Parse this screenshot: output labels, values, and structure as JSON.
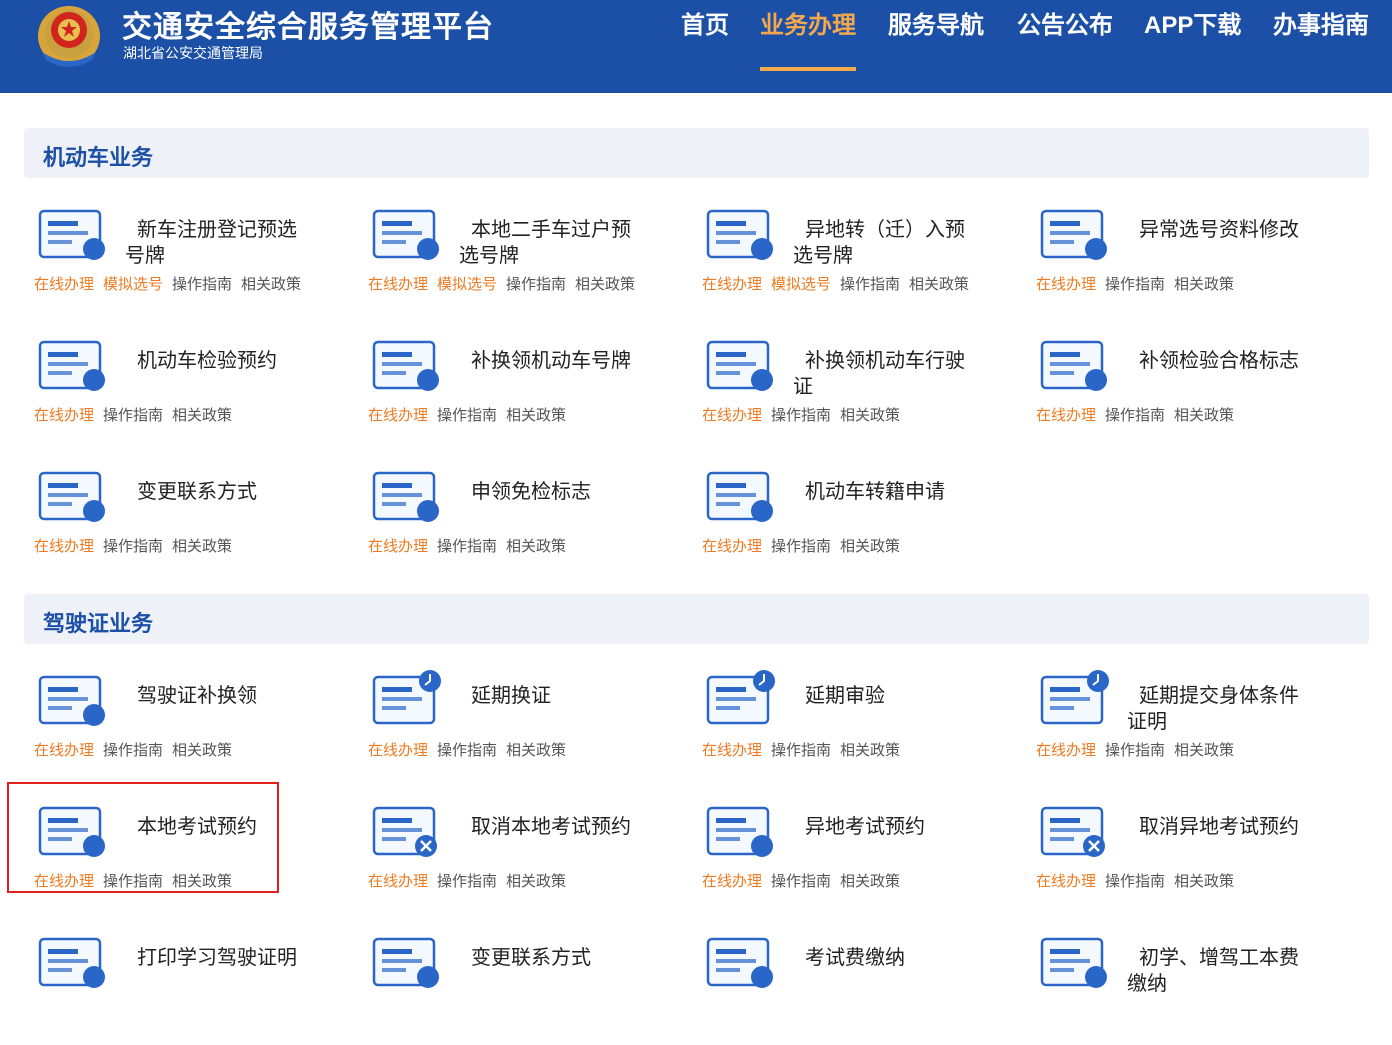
{
  "header": {
    "title": "交通安全综合服务管理平台",
    "subtitle": "湖北省公安交通管理局",
    "nav": [
      {
        "label": "首页",
        "active": false
      },
      {
        "label": "业务办理",
        "active": true
      },
      {
        "label": "服务导航",
        "active": false
      },
      {
        "label": "公告公布",
        "active": false
      },
      {
        "label": "APP下载",
        "active": false
      },
      {
        "label": "办事指南",
        "active": false
      }
    ]
  },
  "sections": [
    {
      "title": "机动车业务",
      "cards": [
        {
          "title": "新车注册登记预选号牌",
          "icon": "plate-registration-icon",
          "links": [
            "在线办理",
            "模拟选号",
            "操作指南",
            "相关政策"
          ]
        },
        {
          "title": "本地二手车过户预选号牌",
          "icon": "car-transfer-icon",
          "links": [
            "在线办理",
            "模拟选号",
            "操作指南",
            "相关政策"
          ]
        },
        {
          "title": "异地转（迁）入预选号牌",
          "icon": "car-relocate-icon",
          "links": [
            "在线办理",
            "模拟选号",
            "操作指南",
            "相关政策"
          ]
        },
        {
          "title": "异常选号资料修改",
          "icon": "number-edit-icon",
          "links": [
            "在线办理",
            "操作指南",
            "相关政策"
          ]
        },
        {
          "title": "机动车检验预约",
          "icon": "inspection-booking-icon",
          "links": [
            "在线办理",
            "操作指南",
            "相关政策"
          ]
        },
        {
          "title": "补换领机动车号牌",
          "icon": "plate-replace-icon",
          "links": [
            "在线办理",
            "操作指南",
            "相关政策"
          ]
        },
        {
          "title": "补换领机动车行驶证",
          "icon": "license-replace-icon",
          "links": [
            "在线办理",
            "操作指南",
            "相关政策"
          ]
        },
        {
          "title": "补领检验合格标志",
          "icon": "inspection-mark-icon",
          "links": [
            "在线办理",
            "操作指南",
            "相关政策"
          ]
        },
        {
          "title": "变更联系方式",
          "icon": "contact-change-icon",
          "links": [
            "在线办理",
            "操作指南",
            "相关政策"
          ]
        },
        {
          "title": "申领免检标志",
          "icon": "exempt-mark-icon",
          "links": [
            "在线办理",
            "操作指南",
            "相关政策"
          ]
        },
        {
          "title": "机动车转籍申请",
          "icon": "transfer-registry-icon",
          "links": [
            "在线办理",
            "操作指南",
            "相关政策"
          ]
        }
      ]
    },
    {
      "title": "驾驶证业务",
      "cards": [
        {
          "title": "驾驶证补换领",
          "icon": "driver-license-icon",
          "links": [
            "在线办理",
            "操作指南",
            "相关政策"
          ]
        },
        {
          "title": "延期换证",
          "icon": "renewal-delay-icon",
          "links": [
            "在线办理",
            "操作指南",
            "相关政策"
          ]
        },
        {
          "title": "延期审验",
          "icon": "review-delay-icon",
          "links": [
            "在线办理",
            "操作指南",
            "相关政策"
          ]
        },
        {
          "title": "延期提交身体条件证明",
          "icon": "health-cert-delay-icon",
          "links": [
            "在线办理",
            "操作指南",
            "相关政策"
          ]
        },
        {
          "title": "本地考试预约",
          "icon": "exam-booking-icon",
          "links": [
            "在线办理",
            "操作指南",
            "相关政策"
          ]
        },
        {
          "title": "取消本地考试预约",
          "icon": "exam-cancel-icon",
          "links": [
            "在线办理",
            "操作指南",
            "相关政策"
          ]
        },
        {
          "title": "异地考试预约",
          "icon": "remote-exam-booking-icon",
          "links": [
            "在线办理",
            "操作指南",
            "相关政策"
          ]
        },
        {
          "title": "取消异地考试预约",
          "icon": "remote-exam-cancel-icon",
          "links": [
            "在线办理",
            "操作指南",
            "相关政策"
          ]
        },
        {
          "title": "打印学习驾驶证明",
          "icon": "print-learner-cert-icon",
          "links": []
        },
        {
          "title": "变更联系方式",
          "icon": "contact-change-icon",
          "links": []
        },
        {
          "title": "考试费缴纳",
          "icon": "exam-fee-icon",
          "links": []
        },
        {
          "title": "初学、增驾工本费缴纳",
          "icon": "cost-fee-icon",
          "links": []
        }
      ]
    }
  ],
  "colors": {
    "header_bg": "#1c4fa6",
    "accent": "#f5a84c",
    "link_orange": "#ee7b22",
    "icon_blue": "#2a66c8",
    "highlight": "#e02020"
  }
}
